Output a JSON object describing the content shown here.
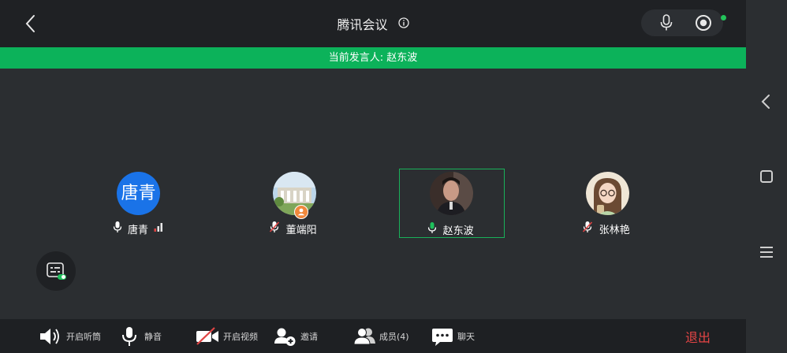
{
  "header": {
    "title": "腾讯会议"
  },
  "speaker_banner": "当前发言人: 赵东波",
  "participants": [
    {
      "name": "唐青",
      "avatar_text": "唐青"
    },
    {
      "name": "董端阳"
    },
    {
      "name": "赵东波"
    },
    {
      "name": "张林艳"
    }
  ],
  "toolbar": {
    "speaker": "开启听筒",
    "mute": "静音",
    "video": "开启视频",
    "invite": "邀请",
    "members": "成员(4)",
    "chat": "聊天",
    "exit": "退出"
  },
  "colors": {
    "accent_green": "#0cb25a",
    "exit_red": "#e64545",
    "avatar_blue": "#1a73e8"
  }
}
